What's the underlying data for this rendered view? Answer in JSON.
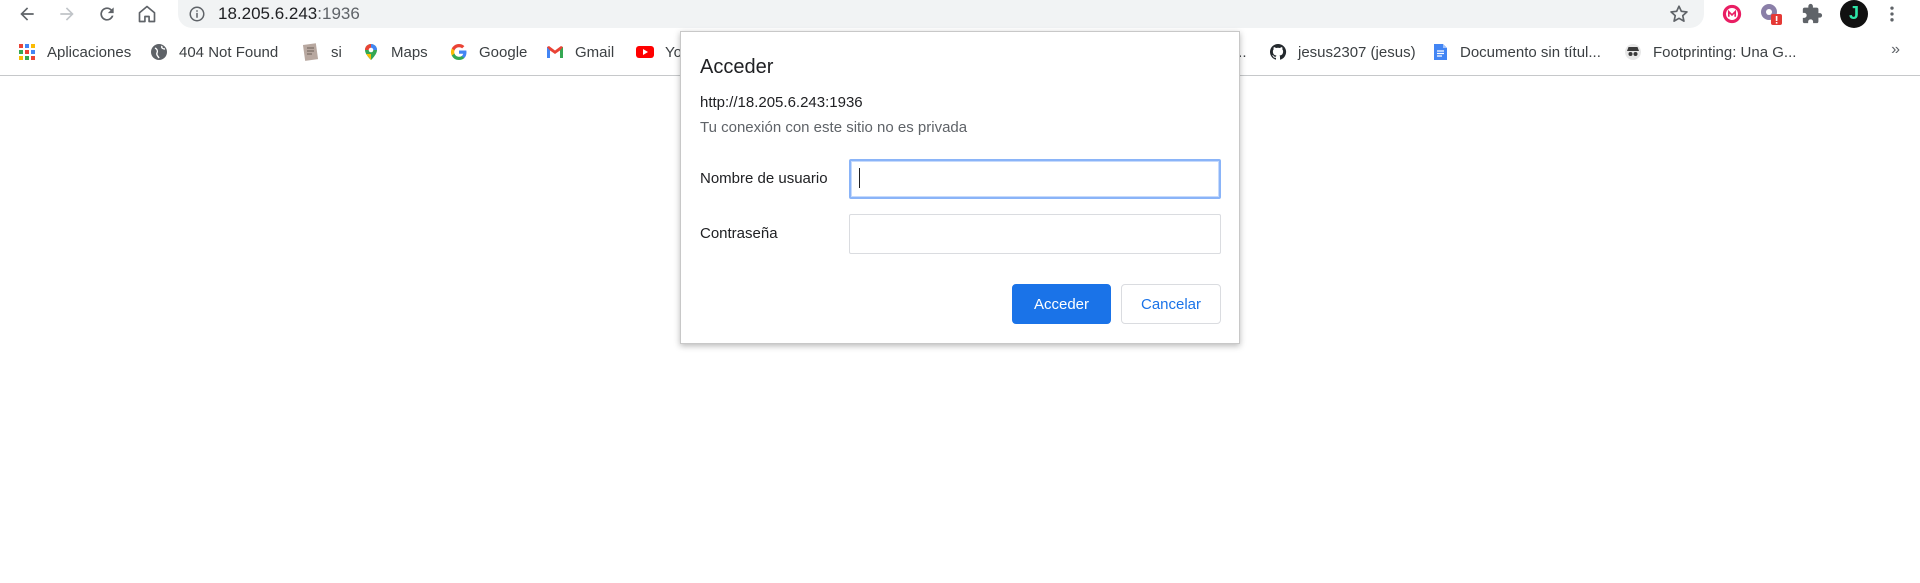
{
  "address_bar": {
    "host": "18.205.6.243",
    "port": ":1936"
  },
  "bookmarks": [
    {
      "label": "Aplicaciones",
      "icon": "apps-grid-icon"
    },
    {
      "label": "404 Not Found",
      "icon": "globe-icon"
    },
    {
      "label": "si",
      "icon": "bookmark-favicon-icon"
    },
    {
      "label": "Maps",
      "icon": "maps-icon"
    },
    {
      "label": "Google",
      "icon": "google-icon"
    },
    {
      "label": "Gmail",
      "icon": "gmail-icon"
    },
    {
      "label": "Yo",
      "icon": "youtube-icon"
    },
    {
      "label": "...",
      "icon": ""
    },
    {
      "label": "jesus2307 (jesus)",
      "icon": "github-icon"
    },
    {
      "label": "Documento sin títul...",
      "icon": "google-docs-icon"
    },
    {
      "label": "Footprinting: Una G...",
      "icon": "spy-favicon-icon"
    }
  ],
  "bookmarks_more": "»",
  "profile_initial": "J",
  "dialog": {
    "title": "Acceder",
    "url": "http://18.205.6.243:1936",
    "warning": "Tu conexión con este sitio no es privada",
    "username_label": "Nombre de usuario",
    "username_value": "",
    "password_label": "Contraseña",
    "password_value": "",
    "submit_label": "Acceder",
    "cancel_label": "Cancelar"
  },
  "colors": {
    "primary": "#1a73e8",
    "omnibox_bg": "#f1f3f4",
    "focus_ring": "#8ab4f8"
  }
}
